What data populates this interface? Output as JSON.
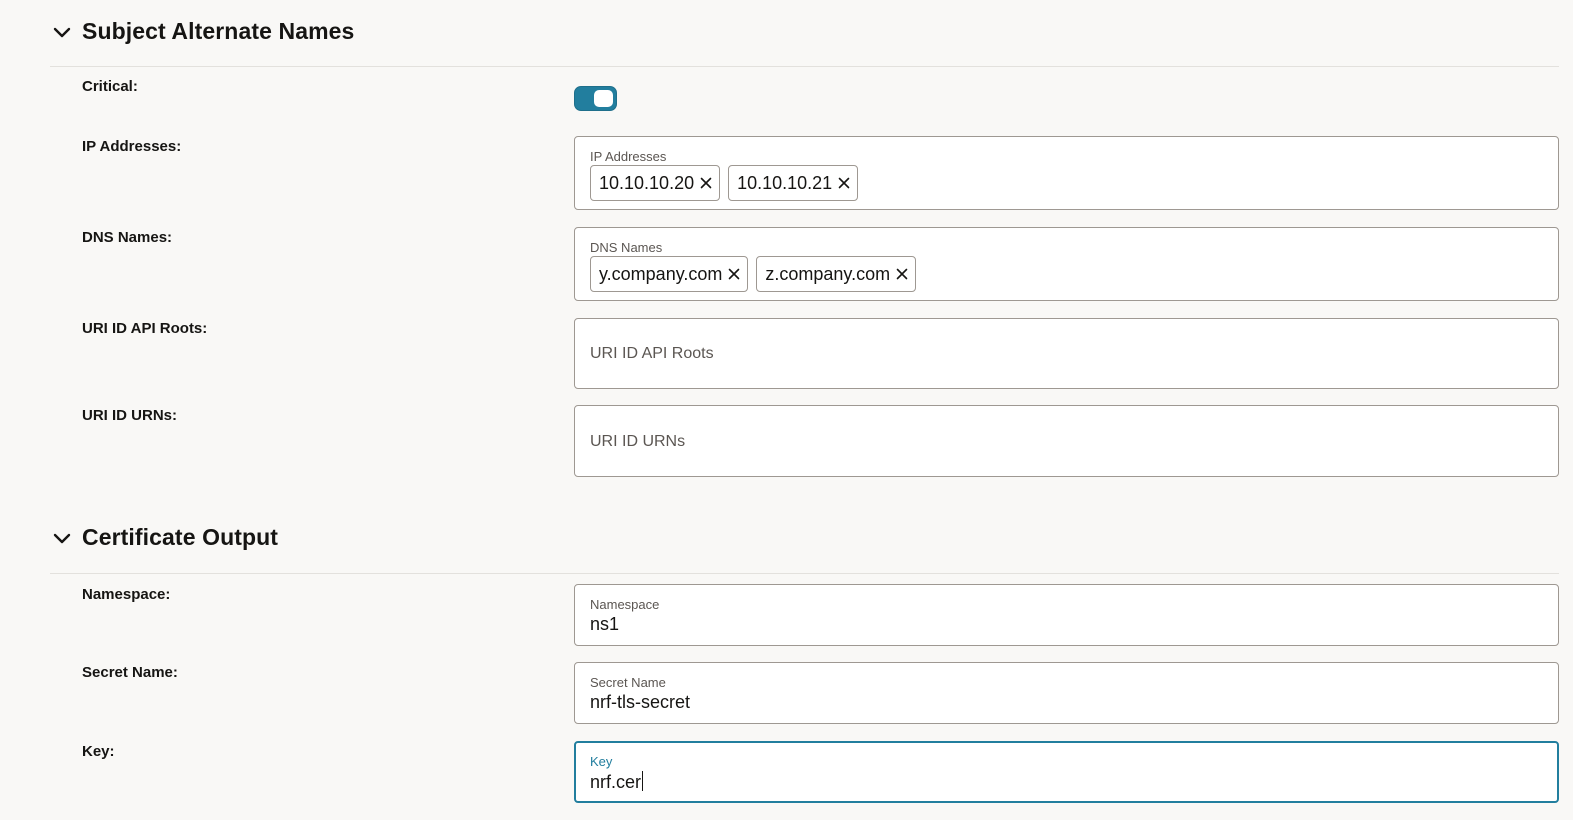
{
  "sections": {
    "san": {
      "title": "Subject Alternate Names"
    },
    "output": {
      "title": "Certificate Output"
    }
  },
  "san_fields": {
    "critical": {
      "label": "Critical:",
      "enabled": true
    },
    "ip_addresses": {
      "label": "IP Addresses:",
      "inner_label": "IP Addresses",
      "chips": [
        "10.10.10.20",
        "10.10.10.21"
      ]
    },
    "dns_names": {
      "label": "DNS Names:",
      "inner_label": "DNS Names",
      "chips": [
        "y.company.com",
        "z.company.com"
      ]
    },
    "uri_api_roots": {
      "label": "URI ID API Roots:",
      "placeholder": "URI ID API Roots"
    },
    "uri_urns": {
      "label": "URI ID URNs:",
      "placeholder": "URI ID URNs"
    }
  },
  "output_fields": {
    "namespace": {
      "label": "Namespace:",
      "inner_label": "Namespace",
      "value": "ns1"
    },
    "secret_name": {
      "label": "Secret Name:",
      "inner_label": "Secret Name",
      "value": "nrf-tls-secret"
    },
    "key": {
      "label": "Key:",
      "inner_label": "Key",
      "value": "nrf.cer"
    }
  },
  "icons": {
    "section_toggle": "chevron-down-icon",
    "chip_remove": "close-icon"
  },
  "colors": {
    "accent": "#227e9e",
    "background": "#f9f8f6",
    "border": "#9e9892",
    "text": "#161513",
    "muted_text": "#5b5652"
  }
}
